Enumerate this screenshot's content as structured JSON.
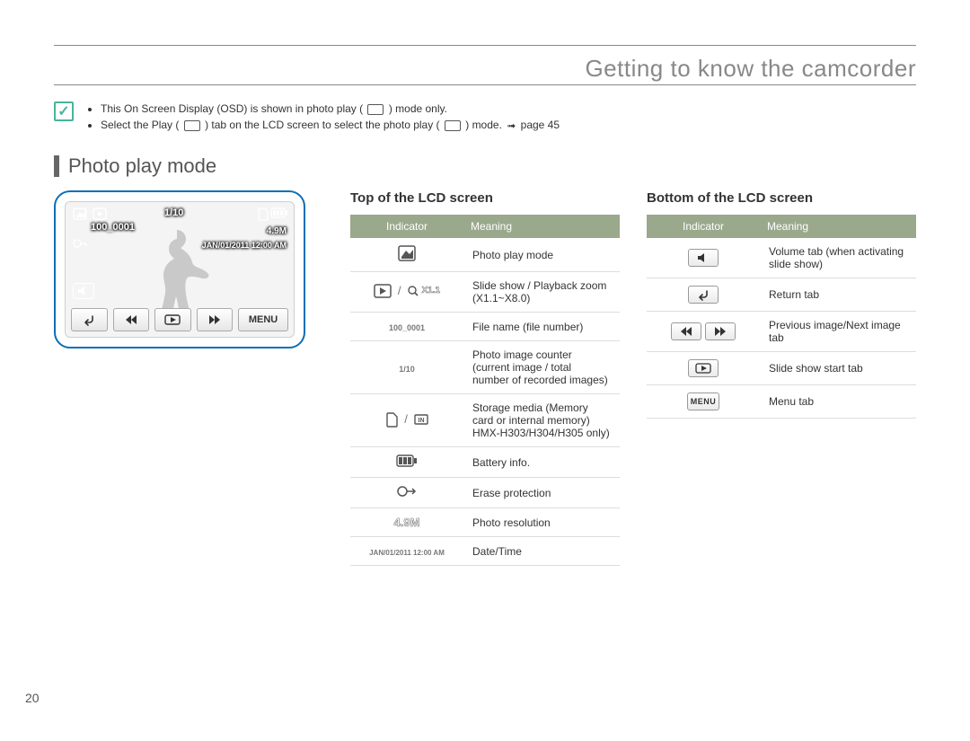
{
  "page_number": "20",
  "chapter_title": "Getting to know the camcorder",
  "notes": {
    "item1a": "This On Screen Display (OSD) is shown in photo play (",
    "item1b": ") mode only.",
    "item2a": "Select the Play (",
    "item2b": ") tab on the LCD screen to select the photo play (",
    "item2c": ") mode. ",
    "item2_pageref": "page 45"
  },
  "section_title": "Photo play mode",
  "lcd": {
    "counter": "1/10",
    "filename": "100_0001",
    "resolution": "4.9M",
    "datetime": "JAN/01/2011 12:00 AM",
    "menu_label": "MENU"
  },
  "table_top": {
    "heading": "Top of the LCD screen",
    "col_indicator": "Indicator",
    "col_meaning": "Meaning",
    "rows": [
      {
        "icon": "photo-play-mode-icon",
        "meaning": "Photo play mode"
      },
      {
        "icon": "slideshow-zoom-icon",
        "zoom_label": "X1.1",
        "meaning": "Slide show / Playback zoom (X1.1~X8.0)"
      },
      {
        "icon": "",
        "label": "100_0001",
        "meaning": "File name (file number)"
      },
      {
        "icon": "",
        "label": "1/10",
        "meaning": "Photo image counter (current image / total number of recorded images)"
      },
      {
        "icon": "storage-icon",
        "meaning": "Storage media (Memory card or internal memory) HMX-H303/H304/H305 only)"
      },
      {
        "icon": "battery-icon",
        "meaning": "Battery info."
      },
      {
        "icon": "protect-icon",
        "meaning": "Erase protection"
      },
      {
        "icon": "",
        "label": "4.9M",
        "meaning": "Photo resolution"
      },
      {
        "icon": "",
        "label": "JAN/01/2011 12:00 AM",
        "meaning": "Date/Time"
      }
    ]
  },
  "table_bottom": {
    "heading": "Bottom of the LCD screen",
    "col_indicator": "Indicator",
    "col_meaning": "Meaning",
    "rows": [
      {
        "icon": "volume-tab-icon",
        "meaning": "Volume tab (when activating slide show)"
      },
      {
        "icon": "return-tab-icon",
        "meaning": "Return tab"
      },
      {
        "icon": "prev-next-tab-icon",
        "meaning": "Previous image/Next image tab"
      },
      {
        "icon": "slideshow-start-tab-icon",
        "meaning": "Slide show start tab"
      },
      {
        "icon": "menu-tab-icon",
        "label": "MENU",
        "meaning": "Menu tab"
      }
    ]
  }
}
